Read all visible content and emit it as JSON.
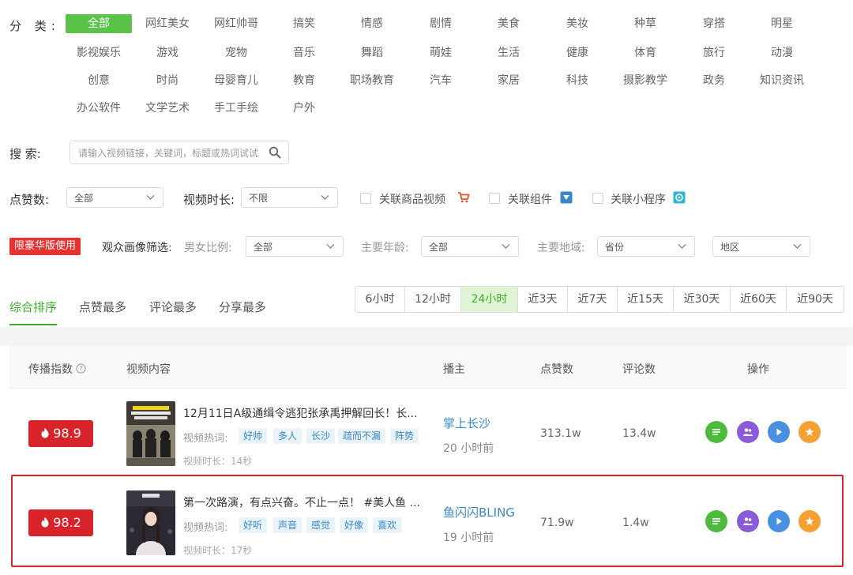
{
  "category": {
    "label": "分 类:",
    "items": [
      "全部",
      "网红美女",
      "网红帅哥",
      "搞笑",
      "情感",
      "剧情",
      "美食",
      "美妆",
      "种草",
      "穿搭",
      "明星",
      "影视娱乐",
      "游戏",
      "宠物",
      "音乐",
      "舞蹈",
      "萌娃",
      "生活",
      "健康",
      "体育",
      "旅行",
      "动漫",
      "创意",
      "时尚",
      "母婴育儿",
      "教育",
      "职场教育",
      "汽车",
      "家居",
      "科技",
      "摄影教学",
      "政务",
      "知识资讯",
      "办公软件",
      "文学艺术",
      "手工手绘",
      "户外"
    ],
    "active_index": 0
  },
  "search": {
    "label": "搜 索:",
    "placeholder": "请输入视频链接，关键词，标题或热词试试"
  },
  "filters": {
    "likes_label": "点赞数:",
    "likes_value": "全部",
    "duration_label": "视频时长:",
    "duration_value": "不限",
    "checkbox_goods": "关联商品视频",
    "checkbox_component": "关联组件",
    "checkbox_miniprogram": "关联小程序"
  },
  "audience": {
    "vip_badge": "限豪华版使用",
    "label": "观众画像筛选:",
    "gender_label": "男女比例:",
    "gender_value": "全部",
    "age_label": "主要年龄:",
    "age_value": "全部",
    "region_label": "主要地域:",
    "province_value": "省份",
    "city_value": "地区"
  },
  "tabs": [
    "综合排序",
    "点赞最多",
    "评论最多",
    "分享最多"
  ],
  "time_ranges": [
    "6小时",
    "12小时",
    "24小时",
    "近3天",
    "近7天",
    "近15天",
    "近30天",
    "近60天",
    "近90天"
  ],
  "time_active_index": 2,
  "table": {
    "headers": {
      "index": "传播指数",
      "content": "视频内容",
      "author": "播主",
      "likes": "点赞数",
      "comments": "评论数",
      "actions": "操作"
    },
    "rows": [
      {
        "score": "98.9",
        "title": "12月11日A级通缉令逃犯张承禹押解回长！长...",
        "hot_label": "视频热词:",
        "tags": [
          "好帅",
          "多人",
          "长沙",
          "疏而不漏",
          "阵势"
        ],
        "duration": "视频时长：14秒",
        "author": "掌上长沙",
        "ago": "20 小时前",
        "likes": "313.1w",
        "comments": "13.4w"
      },
      {
        "score": "98.2",
        "title": "第一次路演，有点兴奋。不止一点！ #美人鱼 ...",
        "hot_label": "视频热词:",
        "tags": [
          "好听",
          "声音",
          "感觉",
          "好像",
          "喜欢"
        ],
        "duration": "视频时长：17秒",
        "author": "鱼闪闪BLING",
        "ago": "19 小时前",
        "likes": "71.9w",
        "comments": "1.4w"
      }
    ]
  },
  "colors": {
    "accent_green": "#5cc34a",
    "score_red": "#d8232a",
    "link_blue": "#3a86c8",
    "op_green": "#4cbb3c",
    "op_purple": "#8a5cdc",
    "op_blue": "#4a90e2",
    "op_orange": "#f5a031"
  }
}
